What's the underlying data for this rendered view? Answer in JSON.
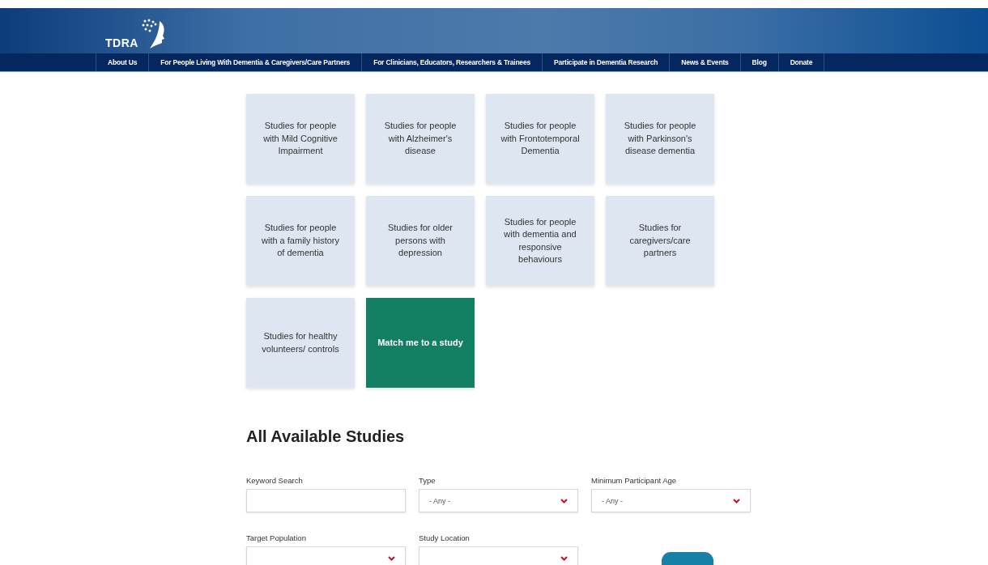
{
  "logo": {
    "text": "TDRA"
  },
  "nav": [
    {
      "label": "About Us"
    },
    {
      "label": "For People Living With Dementia & Caregivers/Care Partners"
    },
    {
      "label": "For Clinicians, Educators, Researchers & Trainees"
    },
    {
      "label": "Participate in Dementia Research"
    },
    {
      "label": "News & Events"
    },
    {
      "label": "Blog"
    },
    {
      "label": "Donate"
    }
  ],
  "tiles": [
    {
      "kind": "category",
      "label": "Studies for people with Mild Cognitive Impairment"
    },
    {
      "kind": "category",
      "label": "Studies for people with Alzheimer's disease"
    },
    {
      "kind": "category",
      "label": "Studies for people with Frontotemporal Dementia"
    },
    {
      "kind": "category",
      "label": "Studies for people with Parkinson's disease dementia"
    },
    {
      "kind": "category",
      "label": "Studies for people with a family history of dementia"
    },
    {
      "kind": "category",
      "label": "Studies for older persons with depression"
    },
    {
      "kind": "category",
      "label": "Studies for people with dementia and responsive behaviours"
    },
    {
      "kind": "category",
      "label": "Studies for caregivers/care partners"
    },
    {
      "kind": "category",
      "label": "Studies for healthy volunteers/ controls"
    },
    {
      "kind": "action",
      "label": "Match me to a study"
    }
  ],
  "heading": "All Available Studies",
  "filters": [
    {
      "kind": "text",
      "label": "Keyword Search"
    },
    {
      "kind": "select",
      "label": "Type",
      "value": "- Any -"
    },
    {
      "kind": "select",
      "label": "Minimum Participant Age",
      "value": "- Any -"
    },
    {
      "kind": "select",
      "label": "Target Population"
    },
    {
      "kind": "select",
      "label": "Study Location"
    },
    {
      "kind": "button"
    }
  ]
}
